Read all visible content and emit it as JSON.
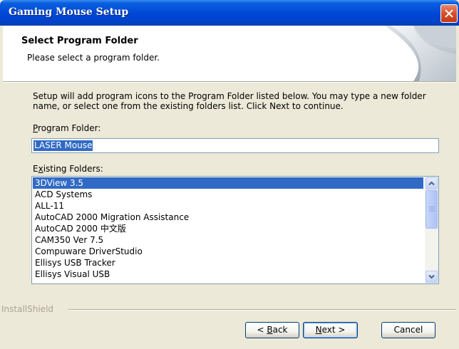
{
  "window": {
    "title": "Gaming Mouse Setup"
  },
  "header": {
    "title": "Select Program Folder",
    "subtitle": "Please select a program folder."
  },
  "instructions": "Setup will add program icons to the Program Folder listed below.  You may type a new folder name, or select one from the existing folders list.  Click Next to continue.",
  "program_folder": {
    "label_accel": "P",
    "label_rest": "rogram Folder:",
    "value": "LASER Mouse"
  },
  "existing_folders": {
    "label_pre": "E",
    "label_accel": "x",
    "label_rest": "isting Folders:",
    "items": [
      "3DView 3.5",
      "ACD Systems",
      "ALL-11",
      "AutoCAD 2000 Migration Assistance",
      "AutoCAD 2000 中文版",
      "CAM350 Ver 7.5",
      "Compuware DriverStudio",
      "Ellisys USB Tracker",
      "Ellisys Visual USB"
    ],
    "selected": "3DView 3.5"
  },
  "footer": {
    "brand": "InstallShield"
  },
  "buttons": {
    "back": {
      "prefix": "< ",
      "accel": "B",
      "rest": "ack"
    },
    "next": {
      "accel": "N",
      "rest": "ext >"
    },
    "cancel": "Cancel"
  },
  "colors": {
    "titlebar": "#0046D5",
    "selection": "#316AC5",
    "face": "#ECE9D8"
  }
}
